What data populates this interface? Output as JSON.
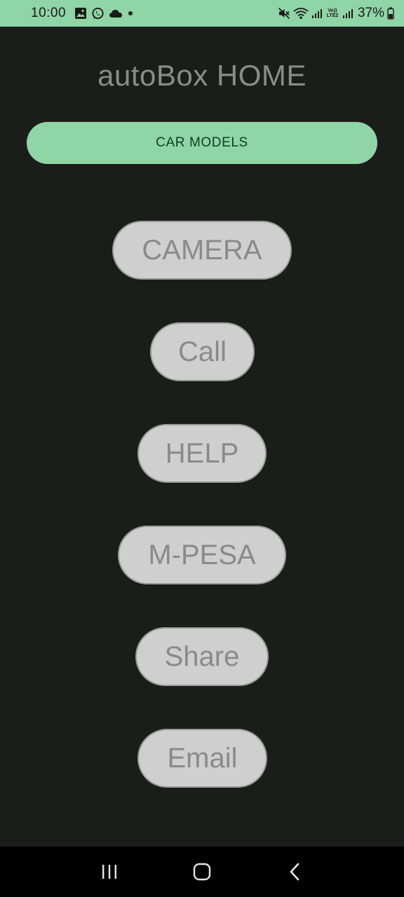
{
  "status_bar": {
    "time": "10:00",
    "battery_percent": "37%",
    "lte_label_top": "Vo))",
    "lte_label_bottom": "LTE2",
    "left_icons": [
      "image-icon",
      "whatsapp-icon",
      "cloud-icon",
      "dot-icon"
    ],
    "right_icons": [
      "mute-icon",
      "wifi-icon",
      "signal-icon",
      "signal-icon",
      "battery-icon"
    ]
  },
  "page": {
    "title": "autoBox HOME"
  },
  "buttons": {
    "car_models": "CAR MODELS",
    "camera": "CAMERA",
    "call": "Call",
    "help": "HELP",
    "mpesa": "M-PESA",
    "share": "Share",
    "email": "Email"
  },
  "colors": {
    "accent": "#8fd5a6",
    "background": "#1b1d1b",
    "pill_background": "#cfcfcf",
    "pill_text": "#8a8a8a"
  },
  "nav_bar": {
    "icons": [
      "recents-icon",
      "home-icon",
      "back-icon"
    ]
  }
}
